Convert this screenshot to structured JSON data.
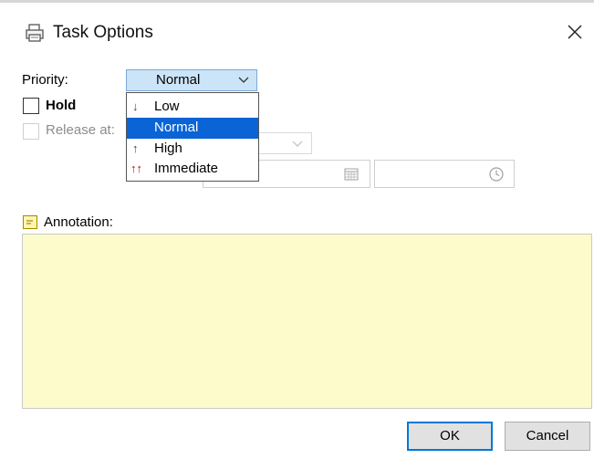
{
  "window": {
    "title": "Task Options",
    "icon": "printer-icon",
    "close_icon": "close-icon"
  },
  "priority": {
    "label": "Priority:",
    "selected": "Normal",
    "options": [
      {
        "label": "Low",
        "icon": "arrow-down-icon"
      },
      {
        "label": "Normal",
        "icon": "",
        "selected": true
      },
      {
        "label": "High",
        "icon": "arrow-up-icon"
      },
      {
        "label": "Immediate",
        "icon": "double-arrow-up-icon"
      }
    ]
  },
  "hold": {
    "label": "Hold",
    "checked": false
  },
  "release": {
    "label": "Release at:",
    "checked": false,
    "enabled": false
  },
  "annotation": {
    "label": "Annotation:",
    "value": ""
  },
  "buttons": {
    "ok": "OK",
    "cancel": "Cancel"
  },
  "colors": {
    "select_bg": "#cce4f7",
    "selected_item": "#0a64d6",
    "annotation_bg": "#fdfbcb",
    "ok_border": "#0078d7",
    "immediate_arrow": "#d40000"
  }
}
